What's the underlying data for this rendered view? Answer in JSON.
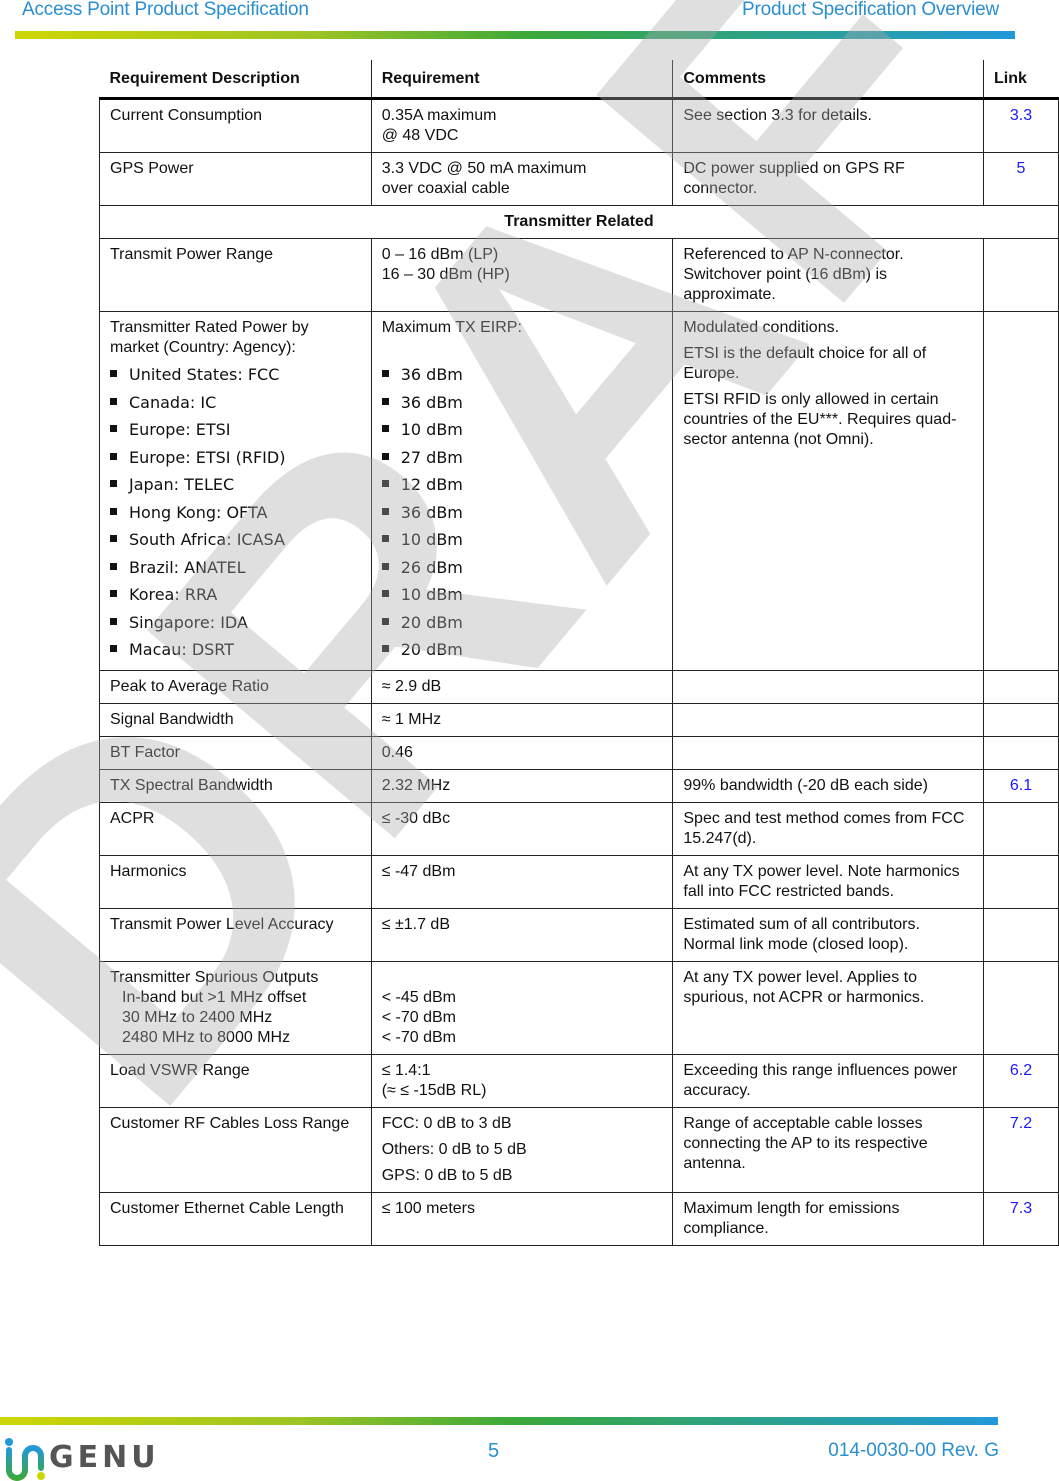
{
  "header": {
    "left_title": "Access Point Product Specification",
    "right_title": "Product Specification Overview"
  },
  "colors": {
    "header_text": "#2a8fd0",
    "link": "#1a1aff",
    "gradient": [
      "#cdd600",
      "#3aa83a",
      "#2199d8"
    ]
  },
  "table": {
    "columns": [
      "Requirement Description",
      "Requirement",
      "Comments",
      "Link"
    ],
    "rows_top": [
      {
        "desc": "Current Consumption",
        "req": [
          "0.35A maximum",
          "@ 48 VDC"
        ],
        "comment": "See section 3.3 for details.",
        "link": "3.3"
      },
      {
        "desc": "GPS Power",
        "req": [
          "3.3 VDC @ 50 mA maximum",
          "over coaxial cable"
        ],
        "comment": "DC power supplied on GPS RF connector.",
        "link": "5"
      }
    ],
    "section_title": "Transmitter Related",
    "transmit_power_range": {
      "desc": "Transmit Power Range",
      "req": [
        "0 – 16 dBm (LP)",
        "16 – 30 dBm (HP)"
      ],
      "comment": "Referenced to AP N-connector. Switchover point (16 dBm) is approximate.",
      "link": ""
    },
    "rated_power": {
      "desc": "Transmitter Rated Power by market (Country: Agency):",
      "req_title": "Maximum TX EIRP:",
      "markets": [
        {
          "market": "United States: FCC",
          "eirp": "36 dBm"
        },
        {
          "market": "Canada: IC",
          "eirp": "36 dBm"
        },
        {
          "market": "Europe: ETSI",
          "eirp": "10 dBm"
        },
        {
          "market": "Europe: ETSI (RFID)",
          "eirp": "27 dBm"
        },
        {
          "market": "Japan: TELEC",
          "eirp": "12 dBm"
        },
        {
          "market": "Hong Kong: OFTA",
          "eirp": "36 dBm"
        },
        {
          "market": "South Africa: ICASA",
          "eirp": "10 dBm"
        },
        {
          "market": "Brazil: ANATEL",
          "eirp": "26 dBm"
        },
        {
          "market": "Korea: RRA",
          "eirp": "10 dBm"
        },
        {
          "market": "Singapore: IDA",
          "eirp": "20 dBm"
        },
        {
          "market": "Macau: DSRT",
          "eirp": "20 dBm"
        }
      ],
      "comments": [
        "Modulated conditions.",
        "ETSI is the default choice for all of Europe.",
        "ETSI RFID is only allowed in certain countries of the EU***. Requires quad-sector antenna (not Omni)."
      ],
      "link": ""
    },
    "rows_simple": [
      {
        "desc": "Peak to Average Ratio",
        "req": "≈ 2.9 dB",
        "comment": "",
        "link": ""
      },
      {
        "desc": "Signal Bandwidth",
        "req": "≈ 1 MHz",
        "comment": "",
        "link": ""
      },
      {
        "desc": "BT Factor",
        "req": "0.46",
        "comment": "",
        "link": ""
      },
      {
        "desc": "TX Spectral Bandwidth",
        "req": "2.32 MHz",
        "comment": "99% bandwidth (-20 dB each side)",
        "link": "6.1"
      },
      {
        "desc": "ACPR",
        "req": "≤ -30 dBc",
        "comment": "Spec and test method comes from FCC 15.247(d).",
        "link": ""
      },
      {
        "desc": "Harmonics",
        "req": "≤ -47 dBm",
        "comment": "At any TX power level. Note harmonics fall into FCC restricted bands.",
        "link": ""
      },
      {
        "desc": "Transmit Power Level Accuracy",
        "req": "≤ ±1.7 dB",
        "comment": "Estimated sum of all contributors. Normal link mode (closed loop).",
        "link": ""
      }
    ],
    "spurious": {
      "desc": "Transmitter Spurious Outputs",
      "sub": [
        "In-band but >1 MHz offset",
        "30 MHz to 2400 MHz",
        "2480 MHz to 8000 MHz"
      ],
      "req": [
        "< -45 dBm",
        "< -70 dBm",
        "< -70 dBm"
      ],
      "comment": "At any TX power level. Applies to spurious, not ACPR or harmonics.",
      "link": ""
    },
    "vswr": {
      "desc": "Load VSWR Range",
      "req": [
        "≤ 1.4:1",
        "(≈ ≤ -15dB RL)"
      ],
      "comment": "Exceeding this range influences power accuracy.",
      "link": "6.2"
    },
    "cables": {
      "desc": "Customer RF Cables Loss Range",
      "req": [
        "FCC: 0 dB to 3 dB",
        "Others: 0 dB to 5 dB",
        "GPS: 0 dB to 5 dB"
      ],
      "comment": "Range of acceptable cable losses connecting the AP to its respective antenna.",
      "link": "7.2"
    },
    "ethernet": {
      "desc": "Customer Ethernet Cable Length",
      "req": "≤ 100 meters",
      "comment": "Maximum length for emissions compliance.",
      "link": "7.3"
    }
  },
  "watermark": "DRAFT",
  "footer": {
    "logo_text": "INGENU",
    "page_number": "5",
    "doc_rev": "014-0030-00 Rev. G"
  }
}
